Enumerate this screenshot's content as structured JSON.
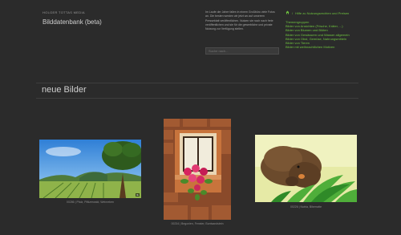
{
  "header": {
    "site_small": "HOLGER TOTTAS MEDIA",
    "site_title": "Bilddatenbank (beta)"
  },
  "intro_text": "Im Laufe der Jahre fallen in einem Großbüro viele Fotos an. Die besten werden wir jetzt wo auf unserem Presseblatt veröffentlichen. Nutzen sie noch nach freie veröffentlichen und sie für die gewerbliche und private Nutzung zur Verfügung stellen.",
  "search": {
    "placeholder": "Suche nach..."
  },
  "breadcrumb": {
    "link": "Hilfe zu Nutzungsrechten und Preisen"
  },
  "topics": {
    "heading": "Themengruppen",
    "items": [
      "Bilder von Ansichten (Frische, Kräter, ...)",
      "Bilder von Blumen und Blüten",
      "Bilder von Gewässern und Wasser allgemein",
      "Bilder von Obst, Gemüse, Nahrungsmitteln",
      "Bilder von Tieren",
      "Bilder mit weihnachtlichen Motiven"
    ]
  },
  "section_title": "neue Bilder",
  "images": [
    {
      "caption": "00286 | Pfalz, Pfälzerwald, Weinreben",
      "badge": "4k"
    },
    {
      "caption": "00234 | Begonien, Fenster, Buntsandstein"
    },
    {
      "caption": "00226 | Nutria, Biberratte"
    }
  ],
  "colors": {
    "background": "#2b2b2b",
    "link": "#6ec23f"
  }
}
